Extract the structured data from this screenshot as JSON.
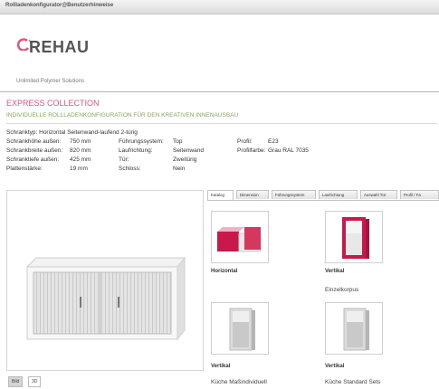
{
  "header": {
    "title": "Rollladenkonfigurator@Benutzerhinweise"
  },
  "brand": {
    "name": "REHAU",
    "tagline": "Unlimited Polymer Solutions",
    "accent": "#e2557f",
    "green": "#8aa55d"
  },
  "page": {
    "collection": "EXPRESS COLLECTION",
    "subtitle": "INDIVIDUELLE ROLLLADENKONFIGURATION FÜR DEN KREATIVEN INNENAUSBAU"
  },
  "specs": {
    "type": "Schranktyp: Horizontal Seitenwand-laufend 2-türig",
    "col1": [
      {
        "label": "Schrankhöhe außen:",
        "value": "750 mm"
      },
      {
        "label": "Schrankbreite außen:",
        "value": "820 mm"
      },
      {
        "label": "Schranktiefe außen:",
        "value": "425 mm"
      },
      {
        "label": "Plattenstärke:",
        "value": "19 mm"
      }
    ],
    "col2": [
      {
        "label": "Führungssystem:",
        "value": "Top"
      },
      {
        "label": "Laufrichtung:",
        "value": "Seitenwand"
      },
      {
        "label": "Tür:",
        "value": "Zweitürig"
      },
      {
        "label": "Schloss:",
        "value": "Nein"
      }
    ],
    "col3": [
      {
        "label": "Profil:",
        "value": "E23"
      },
      {
        "label": "Profilfarbe:",
        "value": "Grau RAL 7035"
      }
    ]
  },
  "view_tabs": [
    "Bild",
    "3D"
  ],
  "tabs": [
    "Katalog",
    "Dimension",
    "Führungssystem",
    "Laufrichtung",
    "Auswahl Tür",
    "Profil / Fa"
  ],
  "catalog": [
    {
      "title": "Horizontal",
      "subtitle": ""
    },
    {
      "title": "Vertikal",
      "subtitle": "Einzelkorpus"
    },
    {
      "title": "Vertikal",
      "subtitle": "Küche Maßindividuell"
    },
    {
      "title": "Vertikal",
      "subtitle": "Küche Standard Sets"
    }
  ]
}
